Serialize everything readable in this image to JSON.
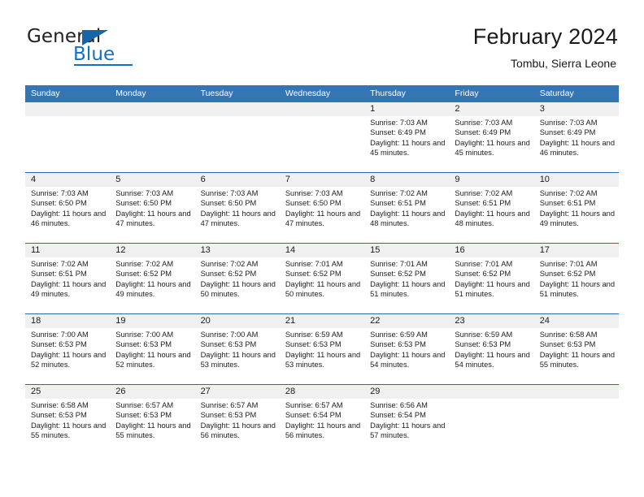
{
  "brand": {
    "name_part1": "General",
    "name_part2": "Blue",
    "triangle_color": "#1565a8",
    "blue_color": "#1271c3"
  },
  "header": {
    "title": "February 2024",
    "subtitle": "Tombu, Sierra Leone"
  },
  "theme": {
    "header_blue": "#3575b4",
    "separator_blue": "#2c6aa8",
    "date_band_gray": "#f0f0f0"
  },
  "weekdays": [
    "Sunday",
    "Monday",
    "Tuesday",
    "Wednesday",
    "Thursday",
    "Friday",
    "Saturday"
  ],
  "labels": {
    "sunrise": "Sunrise:",
    "sunset": "Sunset:",
    "daylight": "Daylight:"
  },
  "weeks": [
    [
      {
        "day": ""
      },
      {
        "day": ""
      },
      {
        "day": ""
      },
      {
        "day": ""
      },
      {
        "day": "1",
        "sunrise": "Sunrise: 7:03 AM",
        "sunset": "Sunset: 6:49 PM",
        "daylight": "Daylight: 11 hours and 45 minutes."
      },
      {
        "day": "2",
        "sunrise": "Sunrise: 7:03 AM",
        "sunset": "Sunset: 6:49 PM",
        "daylight": "Daylight: 11 hours and 45 minutes."
      },
      {
        "day": "3",
        "sunrise": "Sunrise: 7:03 AM",
        "sunset": "Sunset: 6:49 PM",
        "daylight": "Daylight: 11 hours and 46 minutes."
      }
    ],
    [
      {
        "day": "4",
        "sunrise": "Sunrise: 7:03 AM",
        "sunset": "Sunset: 6:50 PM",
        "daylight": "Daylight: 11 hours and 46 minutes."
      },
      {
        "day": "5",
        "sunrise": "Sunrise: 7:03 AM",
        "sunset": "Sunset: 6:50 PM",
        "daylight": "Daylight: 11 hours and 47 minutes."
      },
      {
        "day": "6",
        "sunrise": "Sunrise: 7:03 AM",
        "sunset": "Sunset: 6:50 PM",
        "daylight": "Daylight: 11 hours and 47 minutes."
      },
      {
        "day": "7",
        "sunrise": "Sunrise: 7:03 AM",
        "sunset": "Sunset: 6:50 PM",
        "daylight": "Daylight: 11 hours and 47 minutes."
      },
      {
        "day": "8",
        "sunrise": "Sunrise: 7:02 AM",
        "sunset": "Sunset: 6:51 PM",
        "daylight": "Daylight: 11 hours and 48 minutes."
      },
      {
        "day": "9",
        "sunrise": "Sunrise: 7:02 AM",
        "sunset": "Sunset: 6:51 PM",
        "daylight": "Daylight: 11 hours and 48 minutes."
      },
      {
        "day": "10",
        "sunrise": "Sunrise: 7:02 AM",
        "sunset": "Sunset: 6:51 PM",
        "daylight": "Daylight: 11 hours and 49 minutes."
      }
    ],
    [
      {
        "day": "11",
        "sunrise": "Sunrise: 7:02 AM",
        "sunset": "Sunset: 6:51 PM",
        "daylight": "Daylight: 11 hours and 49 minutes."
      },
      {
        "day": "12",
        "sunrise": "Sunrise: 7:02 AM",
        "sunset": "Sunset: 6:52 PM",
        "daylight": "Daylight: 11 hours and 49 minutes."
      },
      {
        "day": "13",
        "sunrise": "Sunrise: 7:02 AM",
        "sunset": "Sunset: 6:52 PM",
        "daylight": "Daylight: 11 hours and 50 minutes."
      },
      {
        "day": "14",
        "sunrise": "Sunrise: 7:01 AM",
        "sunset": "Sunset: 6:52 PM",
        "daylight": "Daylight: 11 hours and 50 minutes."
      },
      {
        "day": "15",
        "sunrise": "Sunrise: 7:01 AM",
        "sunset": "Sunset: 6:52 PM",
        "daylight": "Daylight: 11 hours and 51 minutes."
      },
      {
        "day": "16",
        "sunrise": "Sunrise: 7:01 AM",
        "sunset": "Sunset: 6:52 PM",
        "daylight": "Daylight: 11 hours and 51 minutes."
      },
      {
        "day": "17",
        "sunrise": "Sunrise: 7:01 AM",
        "sunset": "Sunset: 6:52 PM",
        "daylight": "Daylight: 11 hours and 51 minutes."
      }
    ],
    [
      {
        "day": "18",
        "sunrise": "Sunrise: 7:00 AM",
        "sunset": "Sunset: 6:53 PM",
        "daylight": "Daylight: 11 hours and 52 minutes."
      },
      {
        "day": "19",
        "sunrise": "Sunrise: 7:00 AM",
        "sunset": "Sunset: 6:53 PM",
        "daylight": "Daylight: 11 hours and 52 minutes."
      },
      {
        "day": "20",
        "sunrise": "Sunrise: 7:00 AM",
        "sunset": "Sunset: 6:53 PM",
        "daylight": "Daylight: 11 hours and 53 minutes."
      },
      {
        "day": "21",
        "sunrise": "Sunrise: 6:59 AM",
        "sunset": "Sunset: 6:53 PM",
        "daylight": "Daylight: 11 hours and 53 minutes."
      },
      {
        "day": "22",
        "sunrise": "Sunrise: 6:59 AM",
        "sunset": "Sunset: 6:53 PM",
        "daylight": "Daylight: 11 hours and 54 minutes."
      },
      {
        "day": "23",
        "sunrise": "Sunrise: 6:59 AM",
        "sunset": "Sunset: 6:53 PM",
        "daylight": "Daylight: 11 hours and 54 minutes."
      },
      {
        "day": "24",
        "sunrise": "Sunrise: 6:58 AM",
        "sunset": "Sunset: 6:53 PM",
        "daylight": "Daylight: 11 hours and 55 minutes."
      }
    ],
    [
      {
        "day": "25",
        "sunrise": "Sunrise: 6:58 AM",
        "sunset": "Sunset: 6:53 PM",
        "daylight": "Daylight: 11 hours and 55 minutes."
      },
      {
        "day": "26",
        "sunrise": "Sunrise: 6:57 AM",
        "sunset": "Sunset: 6:53 PM",
        "daylight": "Daylight: 11 hours and 55 minutes."
      },
      {
        "day": "27",
        "sunrise": "Sunrise: 6:57 AM",
        "sunset": "Sunset: 6:53 PM",
        "daylight": "Daylight: 11 hours and 56 minutes."
      },
      {
        "day": "28",
        "sunrise": "Sunrise: 6:57 AM",
        "sunset": "Sunset: 6:54 PM",
        "daylight": "Daylight: 11 hours and 56 minutes."
      },
      {
        "day": "29",
        "sunrise": "Sunrise: 6:56 AM",
        "sunset": "Sunset: 6:54 PM",
        "daylight": "Daylight: 11 hours and 57 minutes."
      },
      {
        "day": ""
      },
      {
        "day": ""
      }
    ]
  ]
}
